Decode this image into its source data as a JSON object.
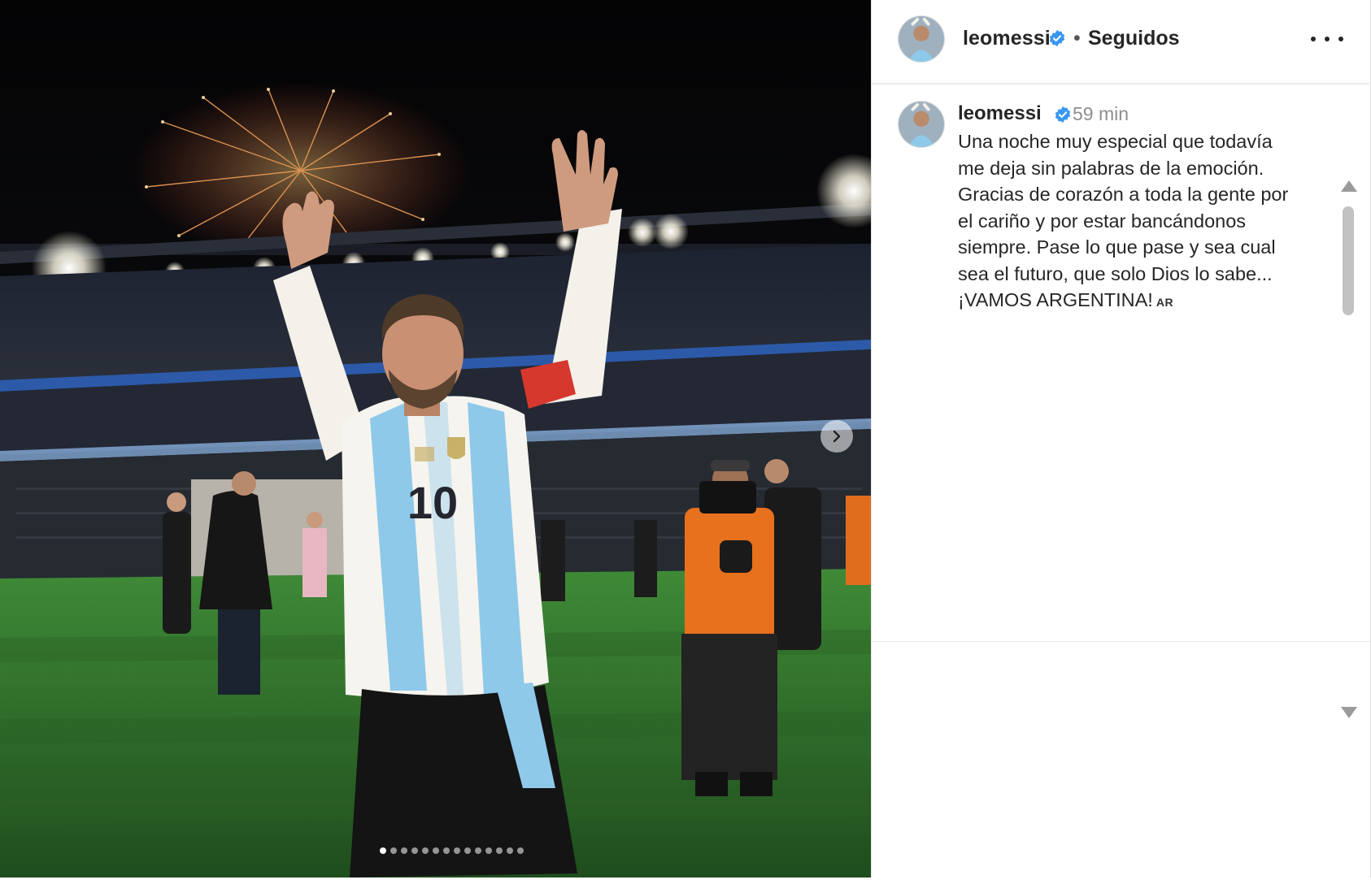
{
  "post": {
    "header": {
      "username": "leomessi",
      "separator": "•",
      "follow_status": "Seguidos"
    },
    "caption": {
      "username": "leomessi",
      "time": "59 min",
      "lines": [
        "Una noche muy especial que todavía",
        "me deja sin palabras de la emoción.",
        "Gracias de corazón a toda la gente por",
        "el cariño y por estar bancándonos",
        "siempre. Pase lo que pase y sea cual",
        "sea el futuro, que solo Dios lo sabe...",
        "¡VAMOS ARGENTINA!"
      ],
      "flag_code": "AR"
    },
    "jersey_number": "10",
    "carousel": {
      "total_slides": 14,
      "active_index": 0
    },
    "icons": {
      "verified": "verified-badge-icon",
      "more": "more-options-icon",
      "next": "chevron-right-icon"
    },
    "colors": {
      "verified_blue": "#3897f0",
      "text_primary": "#262626",
      "text_secondary": "#8e8e8e",
      "jersey_sky": "#8ec9ea",
      "pitch_green": "#2f6d2a"
    }
  }
}
